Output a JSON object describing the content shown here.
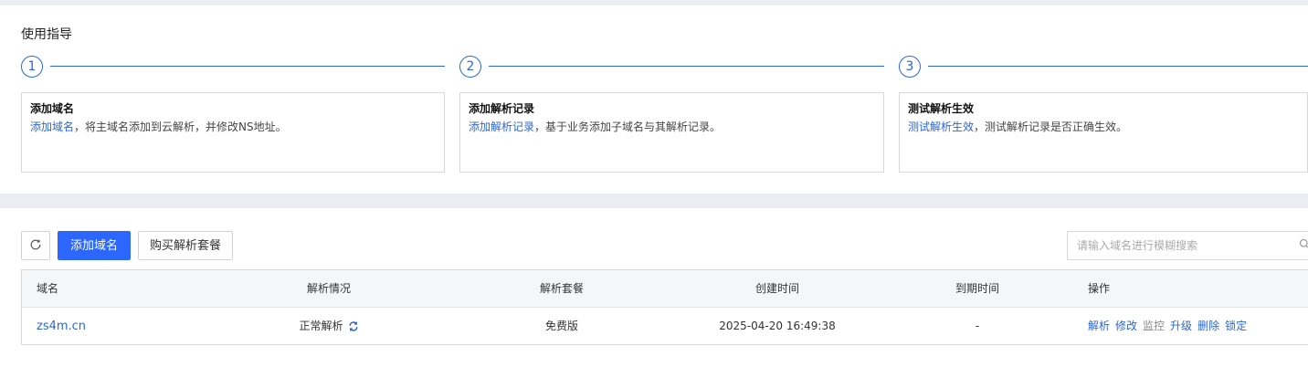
{
  "guide": {
    "title": "使用指导",
    "steps": [
      {
        "number": "1",
        "title": "添加域名",
        "link": "添加域名",
        "desc": "，将主域名添加到云解析，并修改NS地址。"
      },
      {
        "number": "2",
        "title": "添加解析记录",
        "link": "添加解析记录",
        "desc": "，基于业务添加子域名与其解析记录。"
      },
      {
        "number": "3",
        "title": "测试解析生效",
        "link": "测试解析生效",
        "desc": "，测试解析记录是否正确生效。"
      }
    ]
  },
  "toolbar": {
    "add_label": "添加域名",
    "buy_label": "购买解析套餐",
    "search_placeholder": "请输入域名进行模糊搜索"
  },
  "table": {
    "columns": [
      "域名",
      "解析情况",
      "解析套餐",
      "创建时间",
      "到期时间",
      "操作"
    ],
    "rows": [
      {
        "domain": "zs4m.cn",
        "status": "正常解析",
        "plan": "免费版",
        "created": "2025-04-20 16:49:38",
        "expires": "-",
        "actions": [
          "解析",
          "修改",
          "监控",
          "升级",
          "删除",
          "锁定"
        ]
      }
    ]
  },
  "colors": {
    "accent": "#2b66d9",
    "primary_button": "#2b66ff"
  }
}
